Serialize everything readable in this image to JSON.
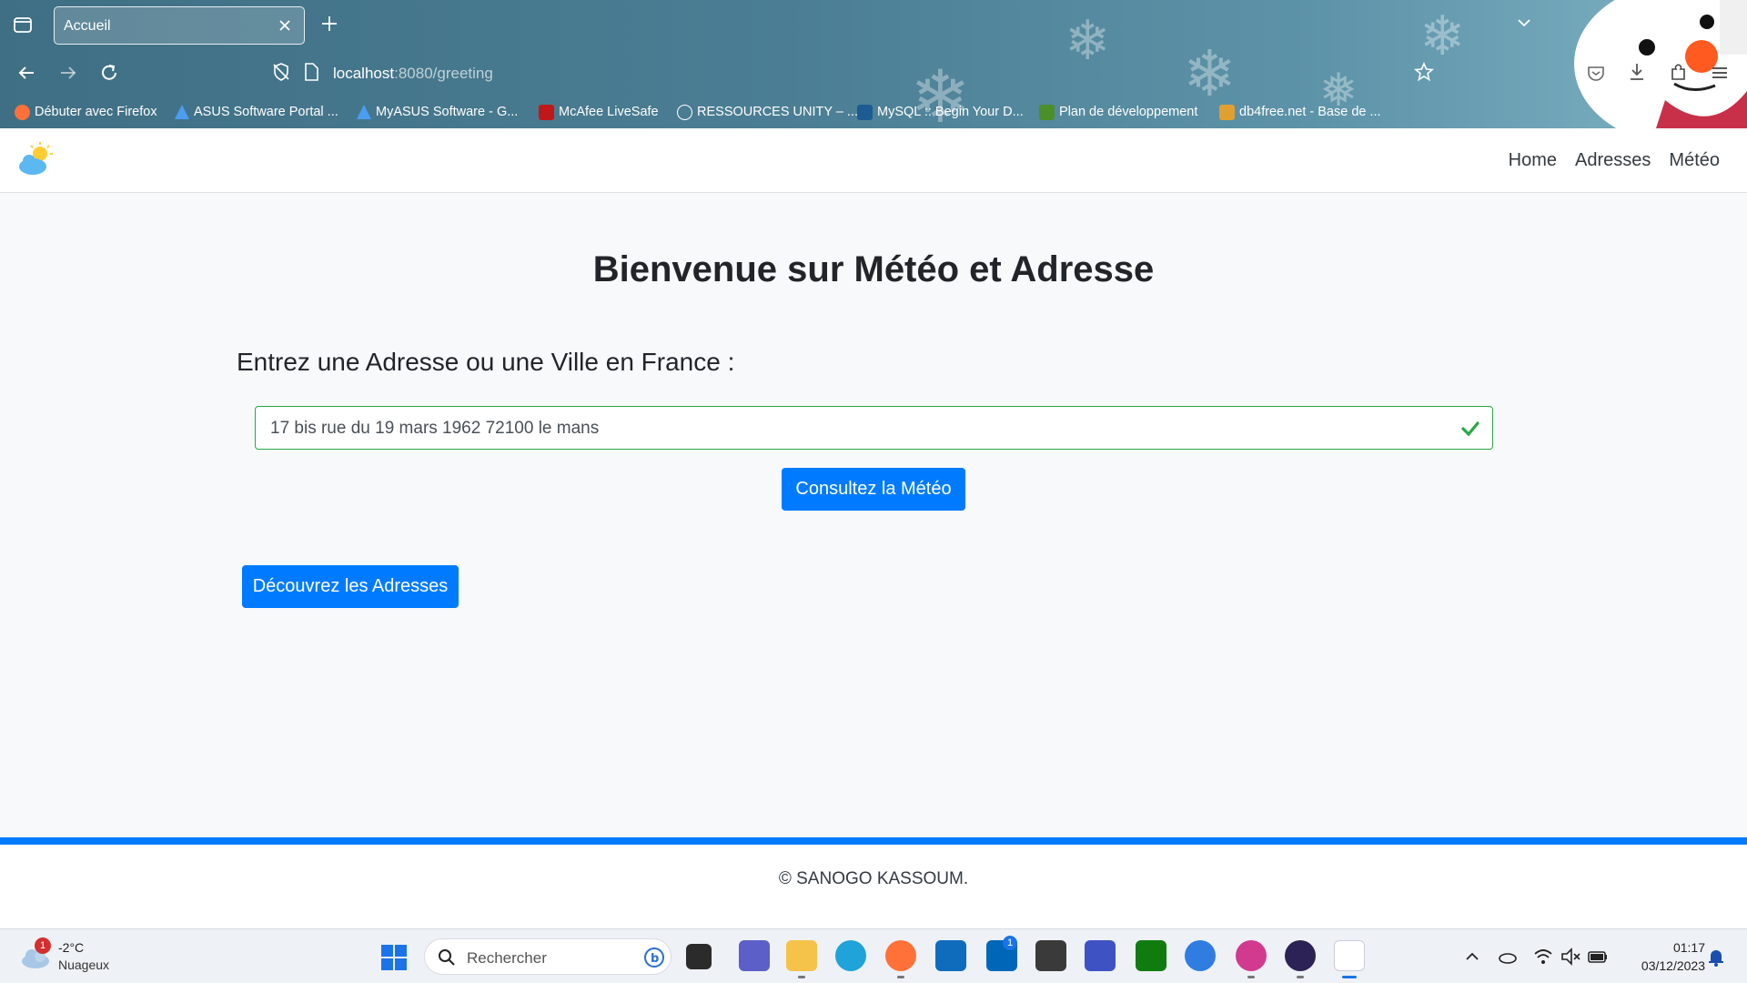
{
  "browser": {
    "tab_title": "Accueil",
    "url_host": "localhost",
    "url_rest": ":8080/greeting",
    "bookmarks": [
      {
        "label": "Débuter avec Firefox",
        "icon": "firefox-icon",
        "color": "#ff7139"
      },
      {
        "label": "ASUS Software Portal ...",
        "icon": "asus-icon",
        "color": "#2b7bd3"
      },
      {
        "label": "MyASUS Software - G...",
        "icon": "asus-icon",
        "color": "#2b7bd3"
      },
      {
        "label": "McAfee LiveSafe",
        "icon": "mcafee-icon",
        "color": "#c01818"
      },
      {
        "label": "RESSOURCES UNITY – ...",
        "icon": "globe-icon",
        "color": "#ffffff"
      },
      {
        "label": "MySQL :: Begin Your D...",
        "icon": "mysql-icon",
        "color": "#1d5c92"
      },
      {
        "label": "Plan de développement",
        "icon": "plan-icon",
        "color": "#4a8f2a"
      },
      {
        "label": "db4free.net - Base de ...",
        "icon": "db4free-icon",
        "color": "#e0a030"
      }
    ]
  },
  "nav": {
    "links": [
      "Home",
      "Adresses",
      "Météo"
    ]
  },
  "main": {
    "title": "Bienvenue sur Météo et Adresse",
    "address_label": "Entrez une Adresse ou une Ville en France :",
    "address_value": "17 bis rue du 19 mars 1962 72100 le mans",
    "meteo_button": "Consultez la Météo",
    "addresses_button": "Découvrez les Adresses"
  },
  "footer": {
    "copyright": "© SANOGO KASSOUM."
  },
  "taskbar": {
    "weather_temp": "-2°C",
    "weather_condition": "Nuageux",
    "weather_badge": "1",
    "search_placeholder": "Rechercher",
    "time": "01:17",
    "date": "03/12/2023",
    "store_badge": "1"
  },
  "colors": {
    "primary": "#007bff",
    "valid": "#28a745",
    "footer_bar": "#007bff"
  }
}
